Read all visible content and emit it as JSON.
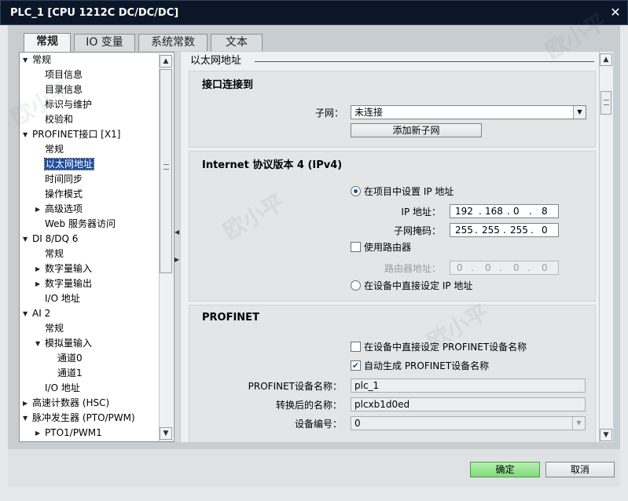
{
  "window": {
    "title": "PLC_1 [CPU 1212C DC/DC/DC]",
    "close_glyph": "✕"
  },
  "tabs": [
    {
      "label": "常规",
      "active": true
    },
    {
      "label": "IO 变量",
      "active": false
    },
    {
      "label": "系统常数",
      "active": false
    },
    {
      "label": "文本",
      "active": false
    }
  ],
  "tree": {
    "items": [
      {
        "label": "常规",
        "level": 0,
        "arrow": "▼"
      },
      {
        "label": "项目信息",
        "level": 1,
        "arrow": ""
      },
      {
        "label": "目录信息",
        "level": 1,
        "arrow": ""
      },
      {
        "label": "标识与维护",
        "level": 1,
        "arrow": ""
      },
      {
        "label": "校验和",
        "level": 1,
        "arrow": ""
      },
      {
        "label": "PROFINET接口 [X1]",
        "level": 0,
        "arrow": "▼"
      },
      {
        "label": "常规",
        "level": 1,
        "arrow": ""
      },
      {
        "label": "以太网地址",
        "level": 1,
        "arrow": "",
        "selected": true
      },
      {
        "label": "时间同步",
        "level": 1,
        "arrow": ""
      },
      {
        "label": "操作模式",
        "level": 1,
        "arrow": ""
      },
      {
        "label": "高级选项",
        "level": 1,
        "arrow": "▶"
      },
      {
        "label": "Web 服务器访问",
        "level": 1,
        "arrow": ""
      },
      {
        "label": "DI 8/DQ 6",
        "level": 0,
        "arrow": "▼"
      },
      {
        "label": "常规",
        "level": 1,
        "arrow": ""
      },
      {
        "label": "数字量输入",
        "level": 1,
        "arrow": "▶"
      },
      {
        "label": "数字量输出",
        "level": 1,
        "arrow": "▶"
      },
      {
        "label": "I/O 地址",
        "level": 1,
        "arrow": ""
      },
      {
        "label": "AI 2",
        "level": 0,
        "arrow": "▼"
      },
      {
        "label": "常规",
        "level": 1,
        "arrow": ""
      },
      {
        "label": "模拟量输入",
        "level": 1,
        "arrow": "▼"
      },
      {
        "label": "通道0",
        "level": 2,
        "arrow": ""
      },
      {
        "label": "通道1",
        "level": 2,
        "arrow": ""
      },
      {
        "label": "I/O 地址",
        "level": 1,
        "arrow": ""
      },
      {
        "label": "高速计数器 (HSC)",
        "level": 0,
        "arrow": "▶"
      },
      {
        "label": "脉冲发生器 (PTO/PWM)",
        "level": 0,
        "arrow": "▼"
      },
      {
        "label": "PTO1/PWM1",
        "level": 1,
        "arrow": "▶"
      }
    ]
  },
  "main": {
    "header": "以太网地址",
    "connect": {
      "title": "接口连接到",
      "subnet_label": "子网：",
      "subnet_value": "未连接",
      "add_subnet_button": "添加新子网"
    },
    "ipv4": {
      "title": "Internet 协议版本 4 (IPv4)",
      "set_in_project": "在项目中设置 IP 地址",
      "ip_label": "IP 地址：",
      "ip": [
        "192",
        "168",
        "0",
        "8"
      ],
      "mask_label": "子网掩码：",
      "mask": [
        "255",
        "255",
        "255",
        "0"
      ],
      "use_router": "使用路由器",
      "router_label": "路由器地址：",
      "router": [
        "0",
        "0",
        "0",
        "0"
      ],
      "set_on_device": "在设备中直接设定 IP 地址"
    },
    "profinet": {
      "title": "PROFINET",
      "set_name_on_device": "在设备中直接设定 PROFINET设备名称",
      "auto_name": "自动生成 PROFINET设备名称",
      "device_name_label": "PROFINET设备名称：",
      "device_name": "plc_1",
      "converted_label": "转换后的名称：",
      "converted_name": "plcxb1d0ed",
      "device_number_label": "设备编号：",
      "device_number": "0"
    }
  },
  "buttons": {
    "ok": "确定",
    "cancel": "取消"
  },
  "watermark": "欧小平",
  "colors": {
    "title_bar": "#0b1629",
    "selection": "#1d4e9e",
    "ok_button": "#8fe28a"
  }
}
